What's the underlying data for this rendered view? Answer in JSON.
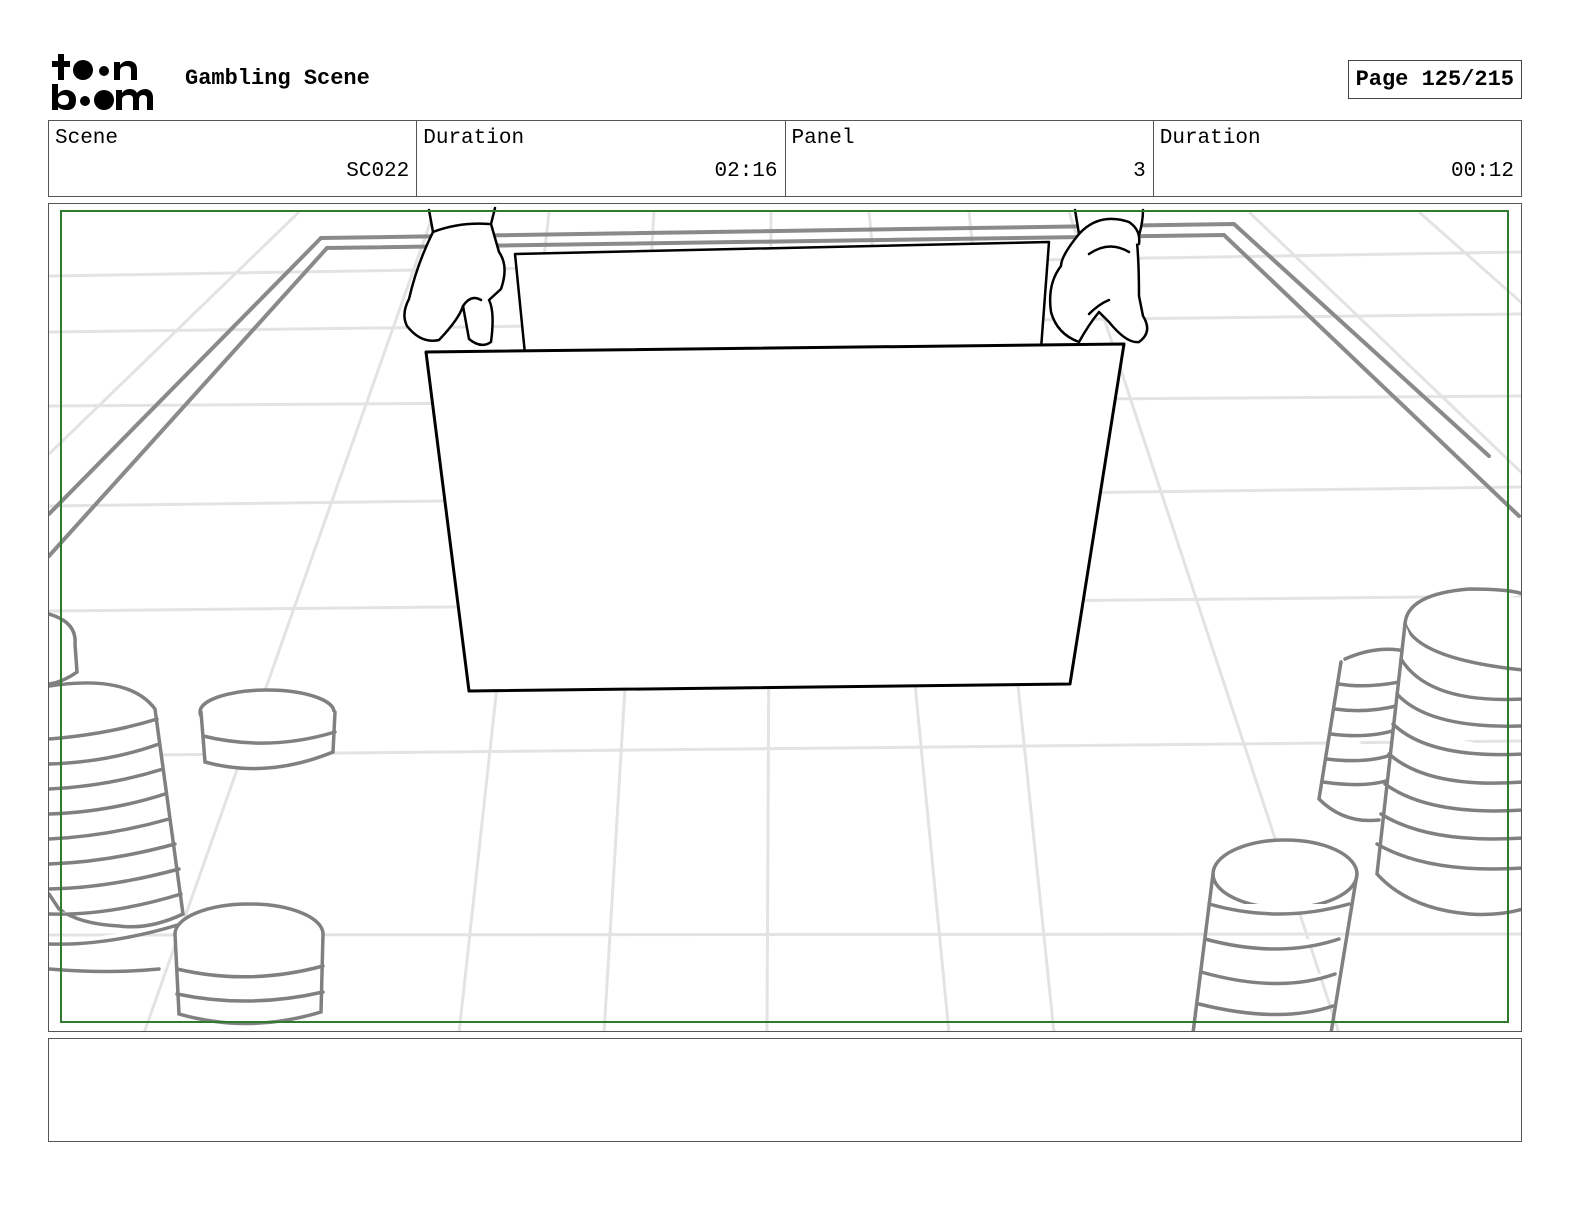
{
  "header": {
    "logo_text_top": "toon",
    "logo_text_bottom": "boom",
    "project_title": "Gambling Scene",
    "page_label": "Page 125/215"
  },
  "info": {
    "scene_label": "Scene",
    "scene_value": "SC022",
    "scene_duration_label": "Duration",
    "scene_duration_value": "02:16",
    "panel_label": "Panel",
    "panel_value": "3",
    "panel_duration_label": "Duration",
    "panel_duration_value": "00:12"
  },
  "panel": {
    "description": "",
    "colors": {
      "grid": "#e3e3e3",
      "rail": "#8a8a8a",
      "chips": "#808080",
      "card": "#000000",
      "safe_frame": "#2f7a2f"
    }
  },
  "notes": {
    "text": ""
  }
}
